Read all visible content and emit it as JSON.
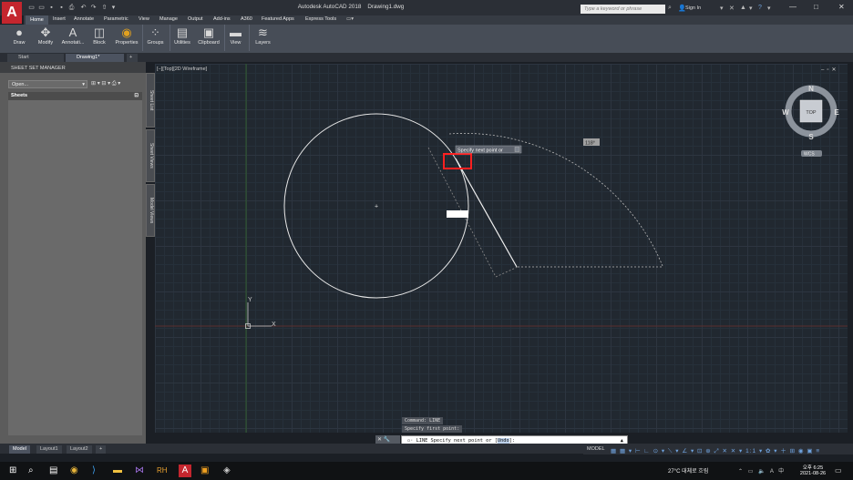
{
  "window": {
    "title": "Autodesk AutoCAD 2018",
    "document": "Drawing1.dwg",
    "app_logo": "A",
    "search_placeholder": "Type a keyword or phrase",
    "sign_in": "Sign In",
    "controls": [
      "—",
      "□",
      "✕"
    ]
  },
  "quick_access": [
    "open-icon",
    "save-icon",
    "saveas-icon",
    "print-icon",
    "undo-icon",
    "redo-icon",
    "share-icon"
  ],
  "menu": {
    "tabs": [
      "Home",
      "Insert",
      "Annotate",
      "Parametric",
      "View",
      "Manage",
      "Output",
      "Add-ins",
      "A360",
      "Featured Apps",
      "Express Tools"
    ],
    "active": "Home"
  },
  "ribbon": {
    "panels": [
      {
        "label": "Draw",
        "icon": "draw-icon"
      },
      {
        "label": "Modify",
        "icon": "modify-icon"
      },
      {
        "label": "Annotati...",
        "icon": "annotation-icon"
      },
      {
        "label": "Block",
        "icon": "block-icon"
      },
      {
        "label": "Properties",
        "icon": "properties-icon"
      },
      {
        "label": "Groups",
        "icon": "groups-icon"
      },
      {
        "label": "Utilities",
        "icon": "utilities-icon"
      },
      {
        "label": "Clipboard",
        "icon": "clipboard-icon"
      },
      {
        "label": "View",
        "icon": "view-icon"
      },
      {
        "label": "Layers",
        "icon": "layers-icon"
      }
    ]
  },
  "doc_tabs": [
    "Start",
    "Drawing1*",
    "+"
  ],
  "sheet_set_manager": {
    "title": "SHEET SET MANAGER",
    "select_value": "Open...",
    "sheets_label": "Sheets",
    "side_tabs": [
      "Sheet List",
      "Sheet Views",
      "Model Views"
    ]
  },
  "viewport": {
    "label": "[−][Top][2D Wireframe]",
    "tooltip": "Specify next point or",
    "angle": "118°",
    "viewcube": {
      "top": "TOP",
      "n": "N",
      "s": "S",
      "e": "E",
      "w": "W",
      "wcs": "WCS"
    },
    "ucs_x": "X",
    "ucs_y": "Y"
  },
  "command": {
    "history": [
      "Command: LINE",
      "Specify first point:"
    ],
    "prompt_prefix": "LINE Specify next point or [",
    "prompt_option": "Undo",
    "prompt_suffix": "]:",
    "caret": "▲"
  },
  "layout_tabs": [
    "Model",
    "Layout1",
    "Layout2",
    "+"
  ],
  "status": {
    "model": "MODEL",
    "icons": "▦ ▦ ▾ ⊢ ∟ ⊙ ▾ ⟍ ▾ ∠ ▾ ⊡ ⊕ ⤢ ✕ ✕ ▾ 1:1 ▾ ✿ ▾ ＋ ⊞ ◉ ▣ ≡"
  },
  "taskbar": {
    "weather": "27°C  대체로 흐림",
    "tray": "⌃ ▭ 🔈 A 中",
    "time": "오후 6:25",
    "date": "2021-08-26"
  }
}
